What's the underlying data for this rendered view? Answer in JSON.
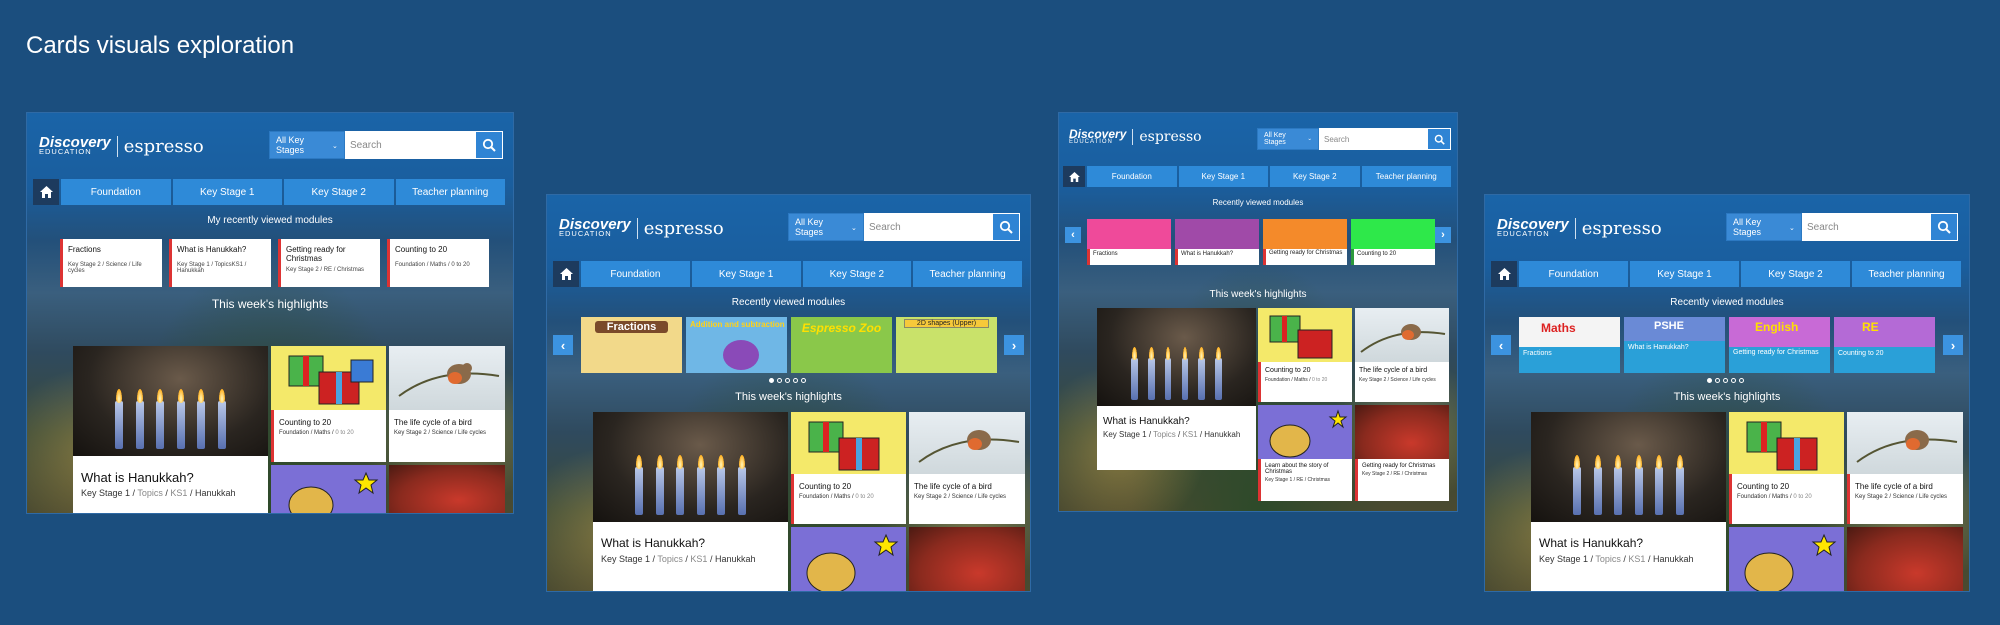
{
  "page": {
    "title": "Cards visuals exploration"
  },
  "brand": {
    "discovery": "Discovery",
    "education": "EDUCATION",
    "espresso": "espresso"
  },
  "search": {
    "stage_select": "All Key Stages",
    "placeholder": "Search"
  },
  "nav": {
    "tabs": [
      "Foundation",
      "Key Stage 1",
      "Key Stage 2",
      "Teacher planning"
    ]
  },
  "frame1": {
    "recent_title": "My recently viewed modules",
    "recent": [
      {
        "title": "Fractions",
        "meta": "Key Stage 2 / Science / Life cycles"
      },
      {
        "title": "What is Hanukkah?",
        "meta": "Key Stage 1 / TopicsKS1 / Hanukkah"
      },
      {
        "title": "Getting ready for Christmas",
        "meta": "Key Stage 2 / RE / Christmas"
      },
      {
        "title": "Counting to 20",
        "meta": "Foundation / Maths / 0 to 20"
      }
    ],
    "highlights_title": "This week's highlights"
  },
  "frame2": {
    "recent_title": "Recently viewed modules",
    "thumbs": [
      "Fractions",
      "Addition and subtraction",
      "Espresso Zoo",
      "2D shapes (Upper)"
    ],
    "highlights_title": "This week's highlights"
  },
  "frame3": {
    "recent_title": "Recently viewed modules",
    "thumbs": [
      "Fractions",
      "What is Hanukkah?",
      "Getting ready for Christmas",
      "Counting to 20"
    ],
    "highlights_title": "This week's highlights"
  },
  "frame4": {
    "recent_title": "Recently viewed modules",
    "thumbs": [
      {
        "badge": "Maths",
        "label": "Fractions"
      },
      {
        "badge": "PSHE",
        "label": "What is Hanukkah?"
      },
      {
        "badge": "English",
        "label": "Getting ready for Christmas"
      },
      {
        "badge": "RE",
        "label": "Counting to 20"
      }
    ],
    "highlights_title": "This week's highlights"
  },
  "highlights": {
    "big": {
      "title": "What is Hanukkah?",
      "ks": "Key Stage 1",
      "sep1": " / ",
      "topic": "Topics",
      "sep2": " / ",
      "ks1": "KS1",
      "sep3": " / ",
      "item": "Hanukkah"
    },
    "counting": {
      "title": "Counting to 20",
      "meta1": "Foundation / Maths / ",
      "meta2": "0 to 20"
    },
    "bird": {
      "title": "The life cycle of a bird",
      "meta": "Key Stage 2 / Science / Life cycles"
    },
    "story": {
      "title": "Learn about the story of Christmas",
      "meta": "Key Stage 1 / RE / Christmas"
    },
    "ready": {
      "title": "Getting ready for Christmas",
      "meta": "Key Stage 2 / RE / Christmas"
    }
  },
  "colors": {
    "background": "#1b4e7e",
    "accent": "#2e8ad8",
    "red_accent": "#dd3333"
  }
}
